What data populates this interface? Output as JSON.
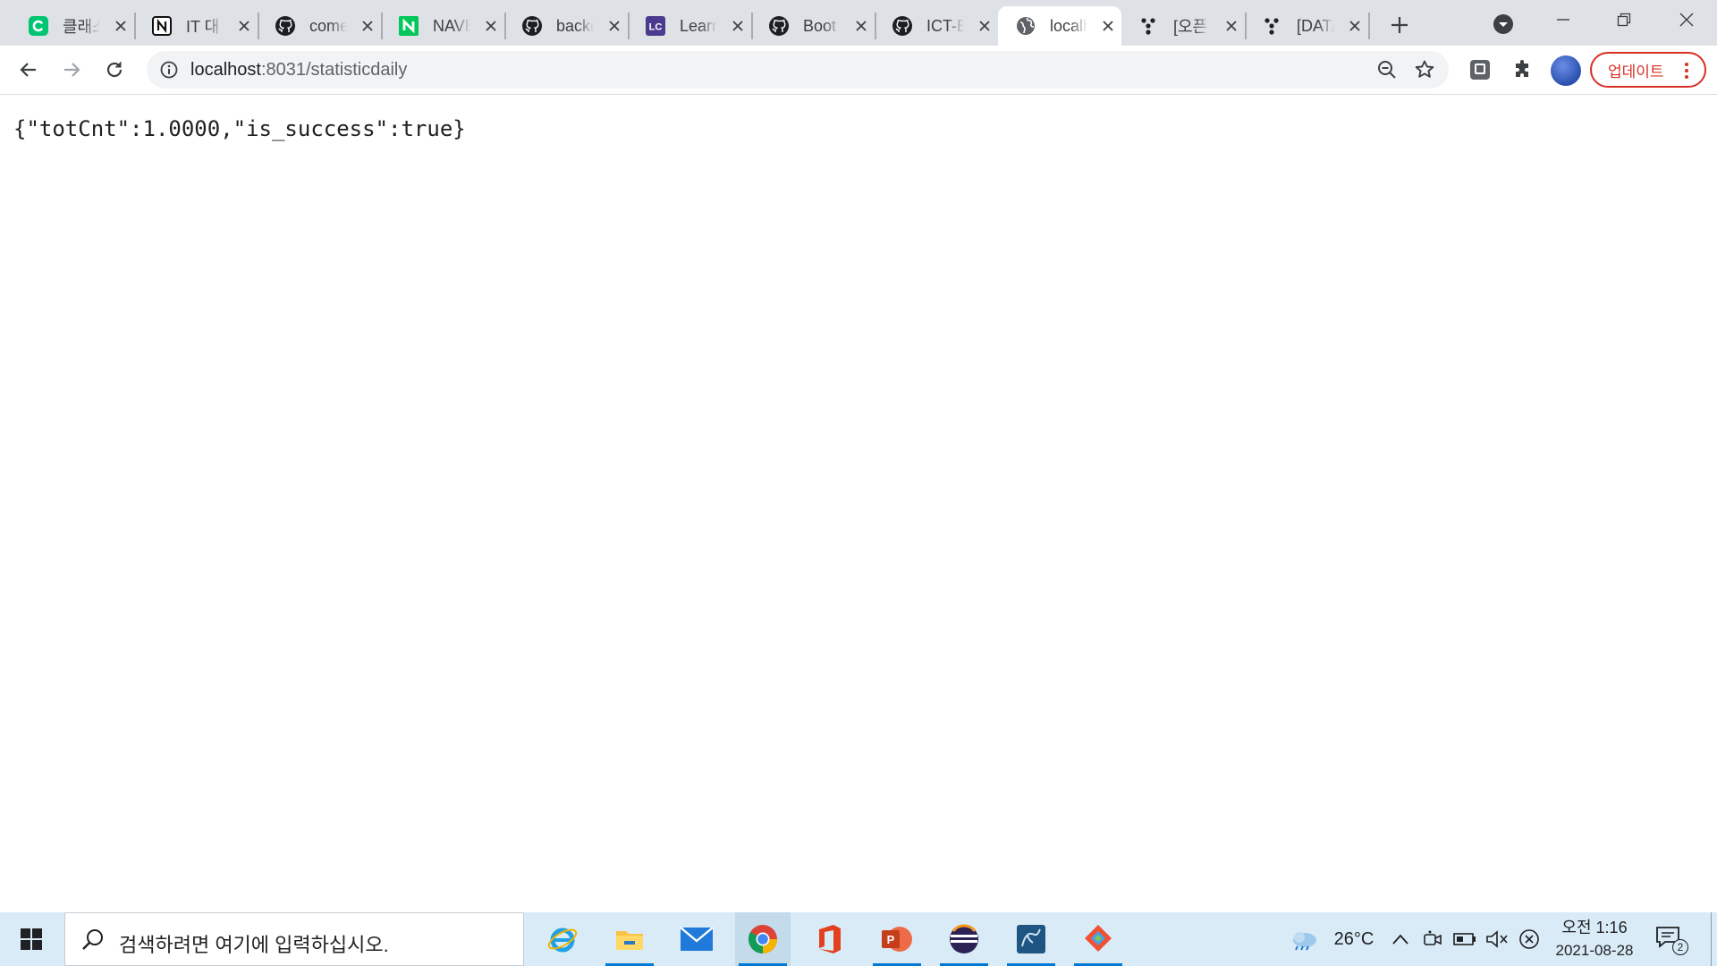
{
  "browser": {
    "tabs": [
      {
        "title": "클래스",
        "icon": "class101-icon",
        "color": "#00c471"
      },
      {
        "title": "IT 대",
        "icon": "notion-icon"
      },
      {
        "title": "come",
        "icon": "github-icon"
      },
      {
        "title": "NAVER",
        "icon": "naver-icon",
        "color": "#03c75a"
      },
      {
        "title": "backe",
        "icon": "github-icon"
      },
      {
        "title": "Learn",
        "icon": "leetcode-icon",
        "color": "#4b3b8f"
      },
      {
        "title": "Boot",
        "icon": "github-icon"
      },
      {
        "title": "ICT-B",
        "icon": "github-icon"
      },
      {
        "title": "localh",
        "icon": "globe-icon",
        "active": true
      },
      {
        "title": "[오픈",
        "icon": "dots-icon"
      },
      {
        "title": "[DATA",
        "icon": "dots-icon"
      }
    ],
    "address": {
      "host": "localhost",
      "path": ":8031/statisticdaily"
    },
    "update_label": "업데이트"
  },
  "page": {
    "json_text": "{\"totCnt\":1.0000,\"is_success\":true}"
  },
  "taskbar": {
    "search_placeholder": "검색하려면 여기에 입력하십시오.",
    "apps": [
      {
        "name": "internet-explorer-icon"
      },
      {
        "name": "file-explorer-icon",
        "running": true
      },
      {
        "name": "mail-icon"
      },
      {
        "name": "chrome-icon",
        "running": true,
        "active": true
      },
      {
        "name": "office-icon"
      },
      {
        "name": "powerpoint-icon",
        "running": true
      },
      {
        "name": "eclipse-icon",
        "running": true
      },
      {
        "name": "mysql-workbench-icon",
        "running": true
      },
      {
        "name": "git-icon",
        "running": true
      }
    ],
    "weather": {
      "temperature": "26°C"
    },
    "clock": {
      "time": "오전 1:16",
      "date": "2021-08-28"
    },
    "notifications": {
      "count": "2"
    }
  }
}
